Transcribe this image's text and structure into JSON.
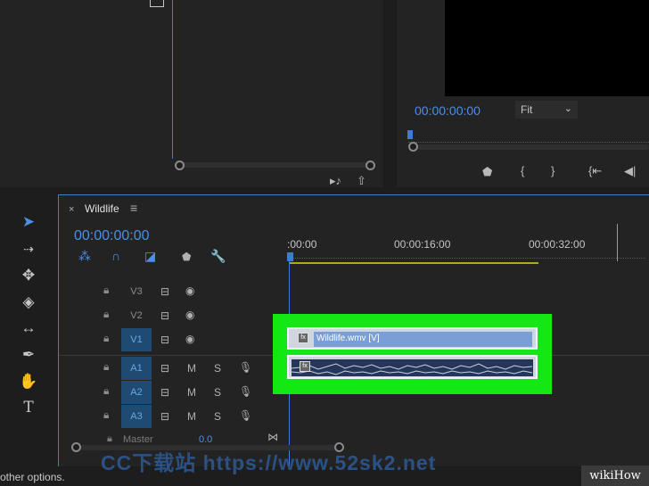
{
  "program": {
    "timecode": "00:00:00:00",
    "fit_label": "Fit"
  },
  "timeline": {
    "tab_title": "Wildlife",
    "close_glyph": "×",
    "menu_glyph": "≡",
    "timecode": "00:00:00:00",
    "ruler": [
      ":00:00",
      "00:00:16:00",
      "00:00:32:00"
    ],
    "tracks": [
      {
        "name": "V3",
        "type": "video"
      },
      {
        "name": "V2",
        "type": "video"
      },
      {
        "name": "V1",
        "type": "video"
      },
      {
        "name": "A1",
        "type": "audio",
        "m": "M",
        "s": "S"
      },
      {
        "name": "A2",
        "type": "audio",
        "m": "M",
        "s": "S"
      },
      {
        "name": "A3",
        "type": "audio",
        "m": "M",
        "s": "S"
      }
    ],
    "master_label": "Master",
    "master_value": "0.0",
    "video_clip_label": "Wildlife.wmv [V]",
    "fx_label": "fx"
  },
  "footer_text": "other options.",
  "watermark": "CC下载站 https://www.52sk2.net",
  "wikihow": "wikiHow",
  "colors": {
    "accent_blue": "#4a8fe8",
    "highlight_green": "#14e814",
    "track_active": "#1f4b73"
  }
}
